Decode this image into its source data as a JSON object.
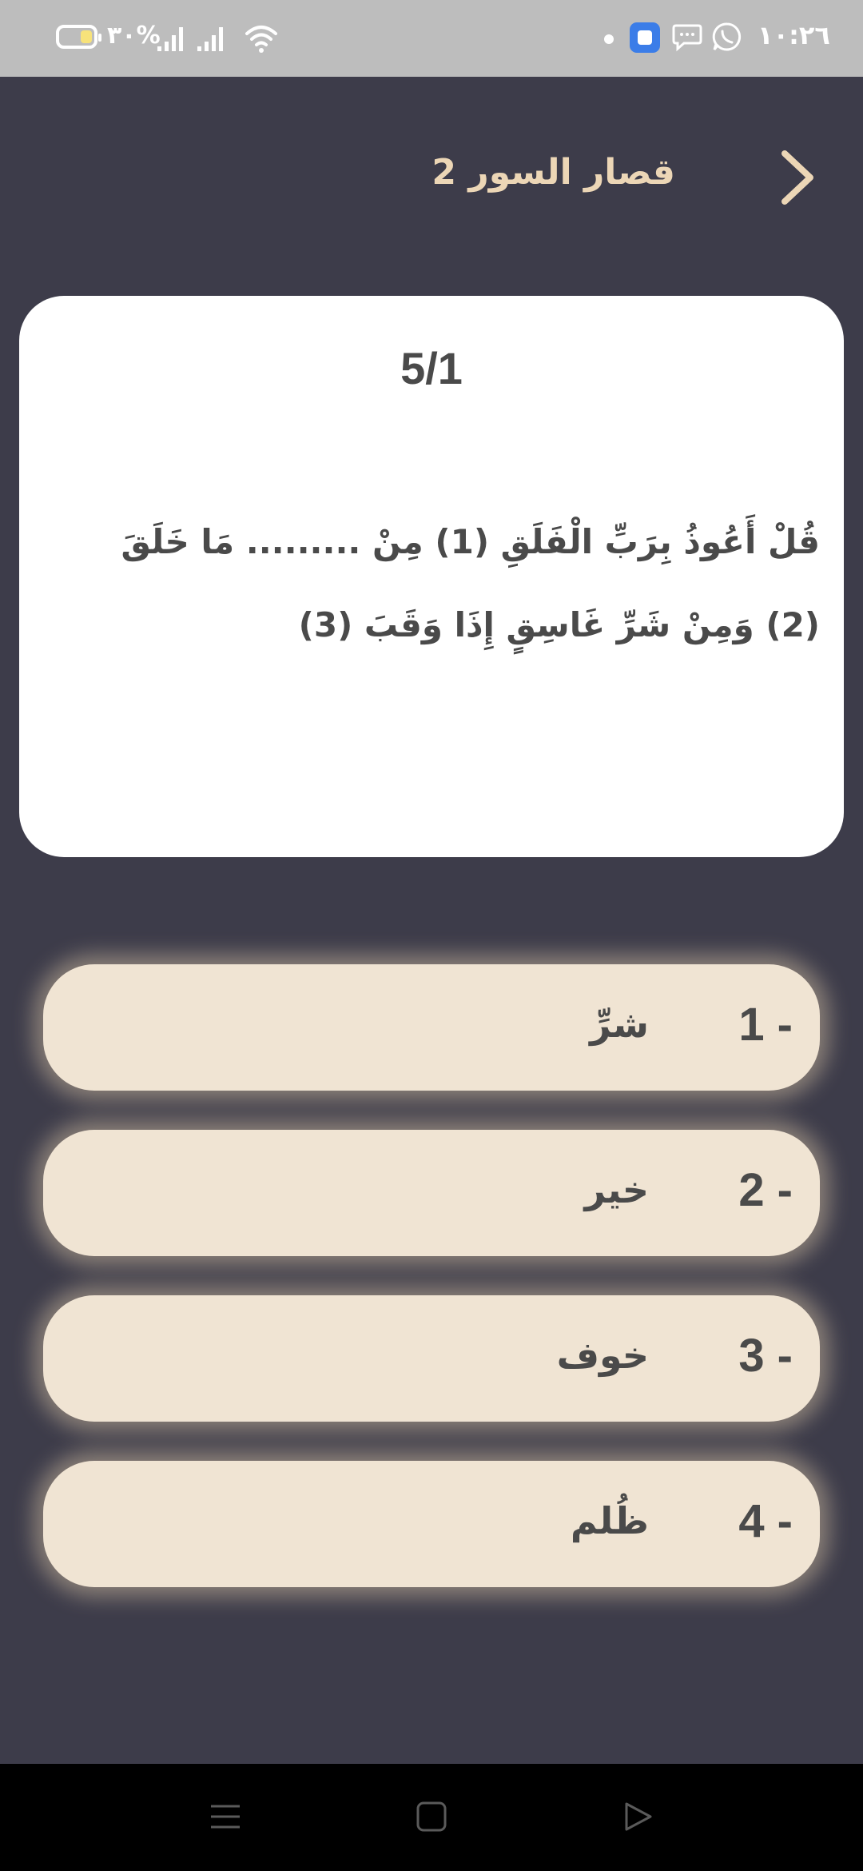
{
  "status_bar": {
    "time": "١٠:٢٦",
    "battery_text": "%٣٠",
    "battery_level": 0.3,
    "icons": [
      "battery-icon",
      "signal-icon",
      "signal-icon",
      "wifi-icon",
      "notification-dot-icon",
      "app-icon",
      "chat-icon",
      "whatsapp-icon"
    ]
  },
  "header": {
    "title": "قصار السور 2",
    "back_icon": "chevron-right-icon"
  },
  "question": {
    "counter": "5/1",
    "text": "قُلْ أَعُوذُ بِرَبِّ الْفَلَقِ (1) مِنْ ......... مَا خَلَقَ (2) وَمِنْ شَرِّ غَاسِقٍ إِذَا وَقَبَ (3)"
  },
  "options": [
    {
      "number": "1 -",
      "text": "شرِّ"
    },
    {
      "number": "2 -",
      "text": "خير"
    },
    {
      "number": "3 -",
      "text": "خوف"
    },
    {
      "number": "4 -",
      "text": "ظُلم"
    }
  ],
  "nav_bar": {
    "icons": [
      "menu-icon",
      "home-icon",
      "back-triangle-icon"
    ]
  },
  "colors": {
    "background": "#3d3c4a",
    "accent": "#ecd6b6",
    "option_bg": "#f0e4d3",
    "card_bg": "#ffffff",
    "text": "#4a4a4a"
  }
}
